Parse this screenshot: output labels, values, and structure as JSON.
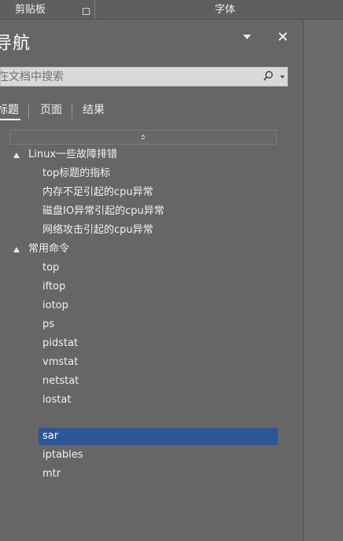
{
  "ribbon": {
    "clipboard_label": "剪贴板",
    "font_label": "字体"
  },
  "nav": {
    "title": "导航",
    "search_placeholder": "在文档中搜索",
    "tabs": [
      {
        "label": "标题",
        "active": true
      },
      {
        "label": "页面",
        "active": false
      },
      {
        "label": "结果",
        "active": false
      }
    ],
    "tree": [
      {
        "label": "Linux一些故障排错",
        "level": 1
      },
      {
        "label": "top标题的指标",
        "level": 2
      },
      {
        "label": "内存不足引起的cpu异常",
        "level": 2
      },
      {
        "label": "磁盘IO异常引起的cpu异常",
        "level": 2
      },
      {
        "label": "网络攻击引起的cpu异常",
        "level": 2
      },
      {
        "label": "常用命令",
        "level": 1
      },
      {
        "label": "top",
        "level": 2
      },
      {
        "label": "iftop",
        "level": 2
      },
      {
        "label": "iotop",
        "level": 2
      },
      {
        "label": "ps",
        "level": 2
      },
      {
        "label": "pidstat",
        "level": 2
      },
      {
        "label": "vmstat",
        "level": 2
      },
      {
        "label": "netstat",
        "level": 2
      },
      {
        "label": "iostat",
        "level": 2
      },
      {
        "label": "sar",
        "level": 2,
        "selected": true
      },
      {
        "label": "iptables",
        "level": 2
      },
      {
        "label": "mtr",
        "level": 2
      }
    ]
  },
  "colors": {
    "selected_row": "#2b579a",
    "pane_bg": "#666666"
  },
  "icons": {
    "close": "close-icon",
    "dropdown": "chevron-down-icon",
    "search": "search-icon"
  }
}
